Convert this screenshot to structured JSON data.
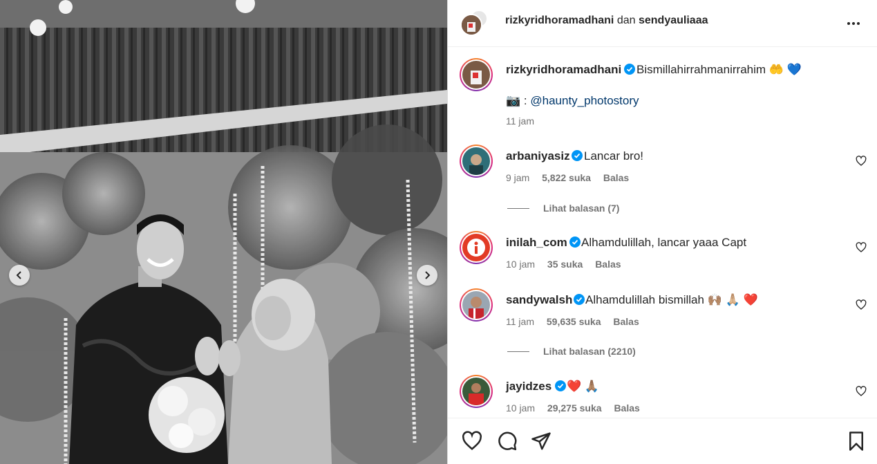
{
  "header": {
    "user1": "rizkyridhoramadhani",
    "conjunction": "dan",
    "user2": "sendyauliaaa"
  },
  "caption": {
    "username": "rizkyridhoramadhani",
    "text": "Bismillahirrahmanirrahim",
    "emojis": "🤲 💙",
    "credit_emoji": "📷",
    "credit_sep": ":",
    "credit_link": "@haunty_photostory",
    "time": "11 jam"
  },
  "comments": [
    {
      "username": "arbaniyasiz",
      "text": "Lancar bro!",
      "time": "9 jam",
      "likes": "5,822 suka",
      "reply": "Balas",
      "view_replies": "Lihat balasan (7)"
    },
    {
      "username": "inilah_com",
      "text": "Alhamdulillah, lancar yaaa Capt",
      "time": "10 jam",
      "likes": "35 suka",
      "reply": "Balas"
    },
    {
      "username": "sandywalsh",
      "text": "Alhamdulillah bismillah",
      "emojis": "🙌🏽 🙏🏼 ❤️",
      "time": "11 jam",
      "likes": "59,635 suka",
      "reply": "Balas",
      "view_replies": "Lihat balasan (2210)"
    },
    {
      "username": "jayidzes",
      "text": "",
      "emojis": "❤️ 🙏🏽",
      "time": "10 jam",
      "likes": "29,275 suka",
      "reply": "Balas"
    }
  ],
  "icons": {
    "verified": "verified-badge-icon",
    "heart": "heart-icon",
    "comment": "comment-icon",
    "share": "share-icon",
    "bookmark": "bookmark-icon",
    "more": "more-icon"
  },
  "colors": {
    "verified": "#0095f6",
    "link": "#00376b",
    "muted": "#737373"
  }
}
